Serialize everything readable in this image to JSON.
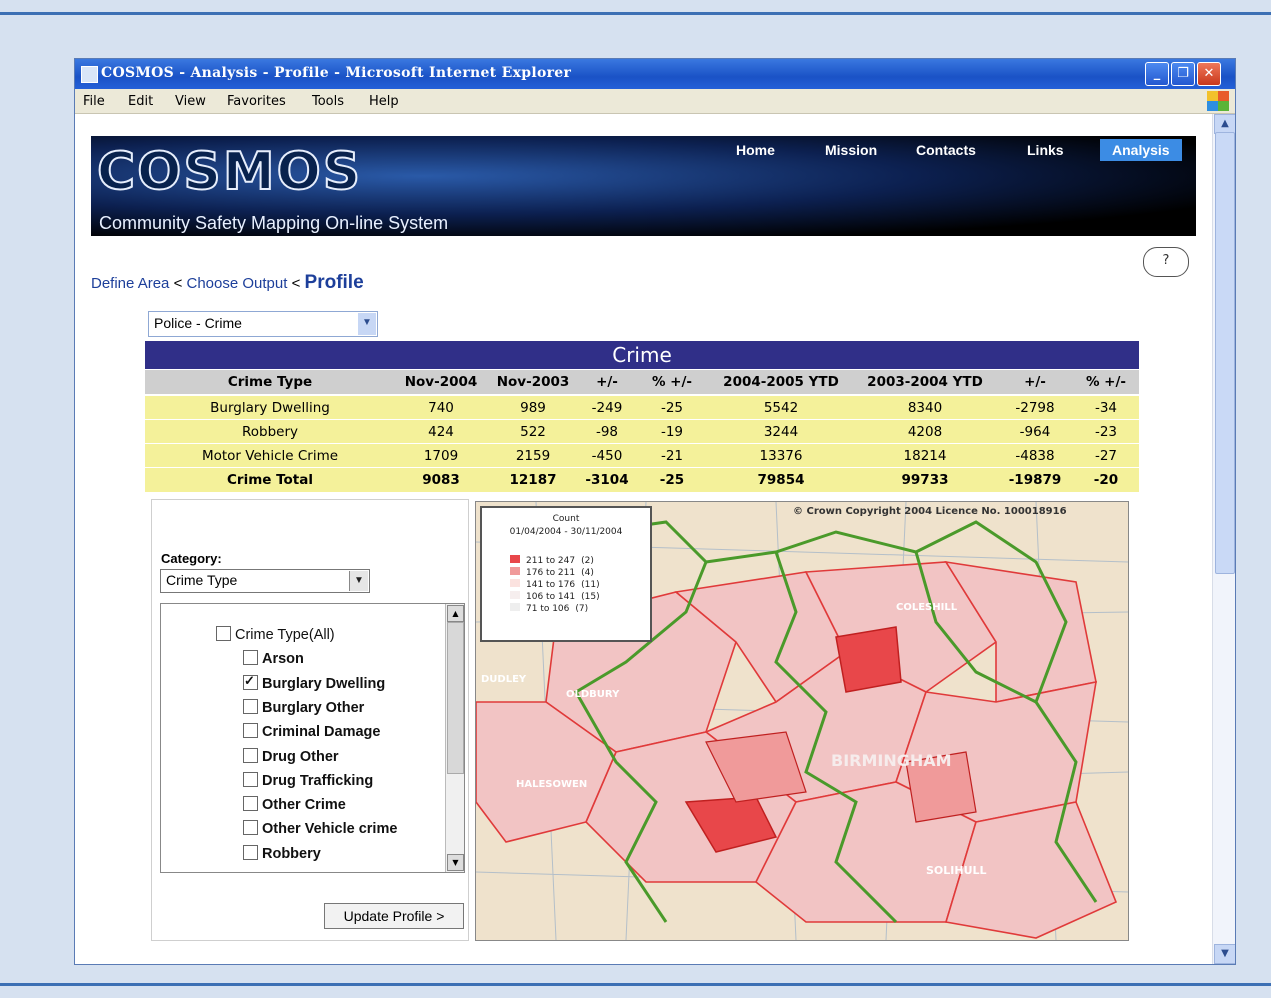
{
  "window": {
    "title": "COSMOS - Analysis - Profile - Microsoft Internet Explorer",
    "controls": {
      "minimize": "_",
      "maximize": "❐",
      "close": "✕"
    }
  },
  "menu": [
    "File",
    "Edit",
    "View",
    "Favorites",
    "Tools",
    "Help"
  ],
  "banner": {
    "logo": "COSMOS",
    "tagline": "Community Safety Mapping On-line System",
    "nav": [
      "Home",
      "Mission",
      "Contacts",
      "Links",
      "Analysis"
    ],
    "active_nav": "Analysis"
  },
  "help_icon": "?",
  "breadcrumb": {
    "step1": "Define Area",
    "sep1": "<",
    "step2": "Choose Output",
    "sep2": "<",
    "current": "Profile"
  },
  "dataset_select": {
    "value": "Police - Crime"
  },
  "table": {
    "title": "Crime",
    "headers": [
      "Crime Type",
      "Nov-2004",
      "Nov-2003",
      "+/-",
      "% +/-",
      "2004-2005 YTD",
      "2003-2004 YTD",
      "+/-",
      "% +/-"
    ],
    "rows": [
      [
        "Burglary Dwelling",
        "740",
        "989",
        "-249",
        "-25",
        "5542",
        "8340",
        "-2798",
        "-34"
      ],
      [
        "Robbery",
        "424",
        "522",
        "-98",
        "-19",
        "3244",
        "4208",
        "-964",
        "-23"
      ],
      [
        "Motor Vehicle Crime",
        "1709",
        "2159",
        "-450",
        "-21",
        "13376",
        "18214",
        "-4838",
        "-27"
      ],
      [
        "Crime Total",
        "9083",
        "12187",
        "-3104",
        "-25",
        "79854",
        "99733",
        "-19879",
        "-20"
      ]
    ]
  },
  "filter": {
    "category_label": "Category:",
    "category_value": "Crime Type",
    "items": [
      {
        "label": "Crime Type(All)",
        "checked": false
      },
      {
        "label": "Arson",
        "checked": false
      },
      {
        "label": "Burglary Dwelling",
        "checked": true
      },
      {
        "label": "Burglary Other",
        "checked": false
      },
      {
        "label": "Criminal Damage",
        "checked": false
      },
      {
        "label": "Drug Other",
        "checked": false
      },
      {
        "label": "Drug Trafficking",
        "checked": false
      },
      {
        "label": "Other Crime",
        "checked": false
      },
      {
        "label": "Other Vehicle crime",
        "checked": false
      },
      {
        "label": "Robbery",
        "checked": false
      }
    ],
    "update_button": "Update Profile >"
  },
  "map": {
    "copyright": "© Crown Copyright 2004 Licence No. 100018916",
    "legend": {
      "title": "Count",
      "period": "01/04/2004 - 30/11/2004",
      "classes": [
        {
          "range": "211 to 247",
          "count": "(2)",
          "color": "#e8474a"
        },
        {
          "range": "176 to 211",
          "count": "(4)",
          "color": "#f09a9a"
        },
        {
          "range": "141 to 176",
          "count": "(11)",
          "color": "#fbe2df"
        },
        {
          "range": "106 to 141",
          "count": "(15)",
          "color": "#f6eeee"
        },
        {
          "range": "71 to 106",
          "count": "(7)",
          "color": "#eeeeee"
        }
      ]
    },
    "place_labels": [
      "BIRMINGHAM",
      "HALESOWEN",
      "OLDBURY",
      "SOLIHULL",
      "COLESHILL",
      "DUDLEY"
    ]
  }
}
